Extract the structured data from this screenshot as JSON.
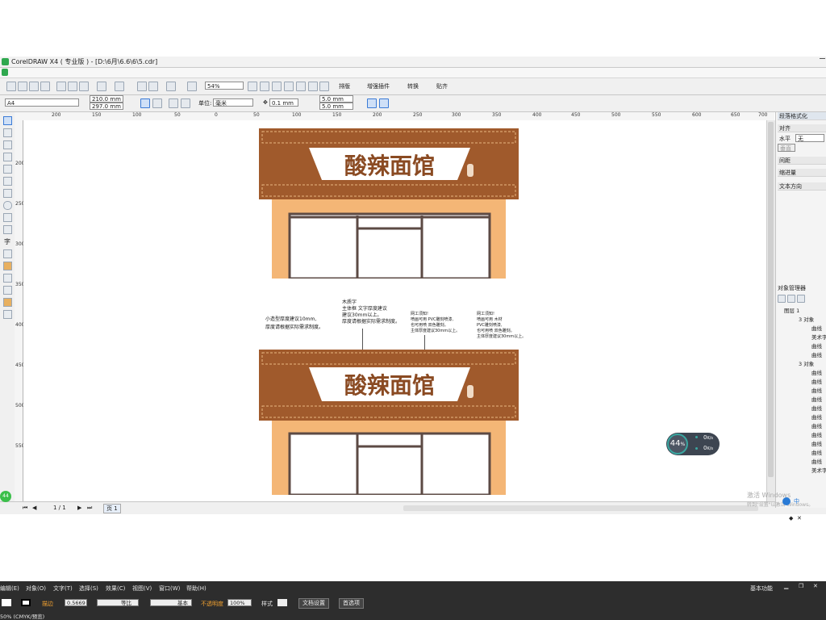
{
  "window": {
    "title": "CorelDRAW X4 ( 专业版 ) - [D:\\6月\\6.6\\6\\5.cdr]"
  },
  "toolbar": {
    "zoom_value": "54%",
    "buttons": [
      "排版",
      "增强插件",
      "转换",
      "贴齐"
    ]
  },
  "propbar": {
    "page_size": "A4",
    "width": "210.0 mm",
    "height": "297.0 mm",
    "unit_label": "单位:",
    "unit_value": "毫米",
    "nudge": "0.1 mm",
    "dup_x": "5.0 mm",
    "dup_y": "5.0 mm"
  },
  "ruler": {
    "h_ticks": [
      "200",
      "150",
      "100",
      "50",
      "0",
      "50",
      "100",
      "150",
      "200",
      "250",
      "300",
      "350",
      "400",
      "450",
      "500",
      "550",
      "600",
      "650",
      "700"
    ],
    "v_ticks": [
      "200",
      "250",
      "300",
      "350",
      "400",
      "450",
      "500",
      "550"
    ]
  },
  "design": {
    "shop_name": "酸辣面馆",
    "note_left_line1": "小造型厚度建议10mm,",
    "note_left_line2": "厚度请根据实际需求制度。",
    "callout1": "木质字\n主体框 文字厚度建议\n建议30mm以上。\n厚度请根据实际需求制度。",
    "callout2": "网工须知!\n喷画可用 PVC雕刻喷漆,\n也可用喷 双色雕刻。\n主体厚度建议30mm以上。",
    "callout3": "网工须知!\n喷画可用 木材\nPVC雕刻喷漆,\n也可用喷 双色雕刻。\n主体厚度建议30mm以上。"
  },
  "statusbar": {
    "page_count": "1 / 1",
    "page_tab": "页 1"
  },
  "dock": {
    "panel_title": "段落格式化",
    "align_label": "对齐",
    "horizontal_label": "水平",
    "horizontal_value": "无",
    "vertical_label": "垂直",
    "spacing_label": "间距",
    "indent_label": "缩进量",
    "text_direction_label": "文本方向",
    "objmgr_title": "对象管理器",
    "obj_items": [
      "图层 1",
      "3 对象",
      "曲线",
      "美术字",
      "曲线",
      "曲线",
      "3 对象",
      "曲线",
      "曲线",
      "曲线",
      "曲线",
      "曲线",
      "曲线",
      "曲线",
      "曲线",
      "曲线",
      "曲线",
      "曲线",
      "美术字"
    ]
  },
  "overlay": {
    "speed_percent": "44",
    "speed_unit": "%",
    "up_rate": "0",
    "down_rate": "0",
    "rate_unit": "K/s",
    "activate_line1": "激活 Windows",
    "activate_line2": "转到\"设置\"以激活 Windows。"
  },
  "bottom": {
    "menu": [
      "编辑(E)",
      "对象(O)",
      "文字(T)",
      "选择(S)",
      "效果(C)",
      "视图(V)",
      "窗口(W)",
      "帮助(H)"
    ],
    "workspace": "基本功能",
    "stroke_label": "描边",
    "stroke_value": "0.5669",
    "line_style1": "等比",
    "line_style2": "基本",
    "opacity_label": "不透明度",
    "opacity_value": "100%",
    "style_label": "样式",
    "doc_settings": "文档设置",
    "preferences": "首选项",
    "status_text": "50% (CMYK/预览)"
  },
  "colors": {
    "sign_brown": "#a05a2c",
    "sign_orange": "#f4b676",
    "frame_dark": "#5c4a44",
    "accent_teal": "#3aa6a0"
  }
}
